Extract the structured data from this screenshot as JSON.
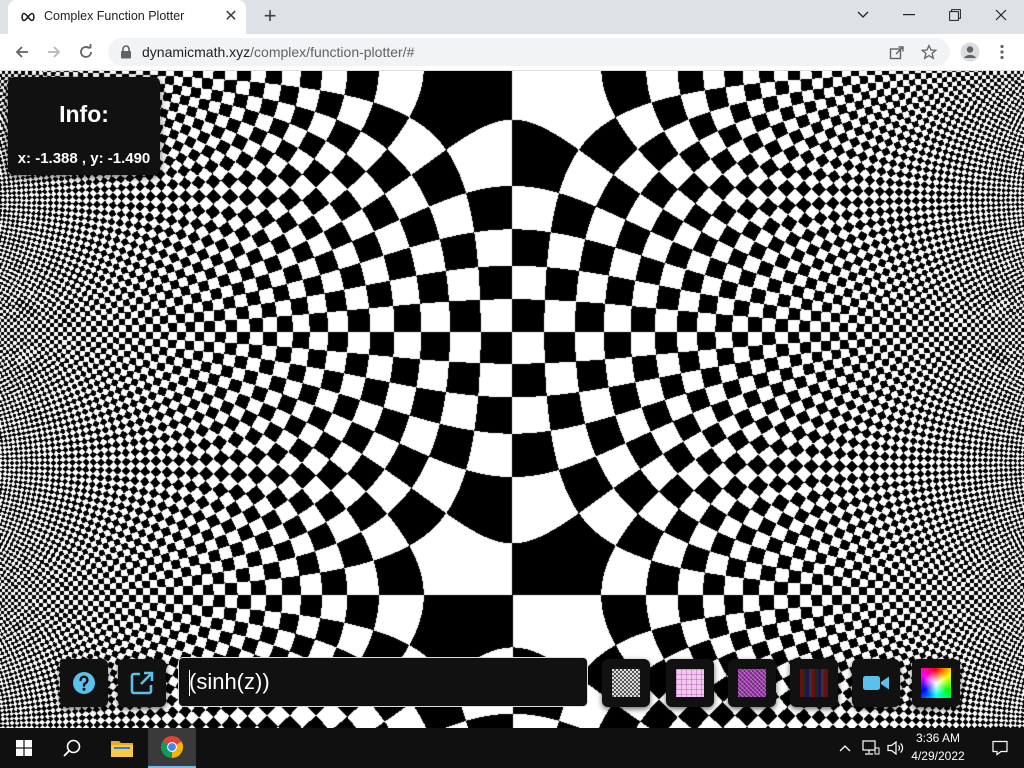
{
  "browser": {
    "tab_title": "Complex Function Plotter",
    "url_domain": "dynamicmath.xyz",
    "url_path": "/complex/function-plotter/#"
  },
  "info": {
    "title": "Info:",
    "coords": "x: -1.388 , y: -1.490"
  },
  "controls": {
    "function_value": "(sinh(z))",
    "swatches": [
      {
        "name": "gray-checker",
        "color": "#9a9a9a"
      },
      {
        "name": "pink-grid",
        "color": "#f0c8f0"
      },
      {
        "name": "purple-texture",
        "color": "#9933aa"
      },
      {
        "name": "dark-stripes",
        "color": "#333333"
      },
      {
        "name": "camera",
        "color": "#5bc0eb"
      },
      {
        "name": "color-wheel",
        "color": "#ff00ff"
      }
    ]
  },
  "taskbar": {
    "time": "3:36 AM",
    "date": "4/29/2022"
  }
}
